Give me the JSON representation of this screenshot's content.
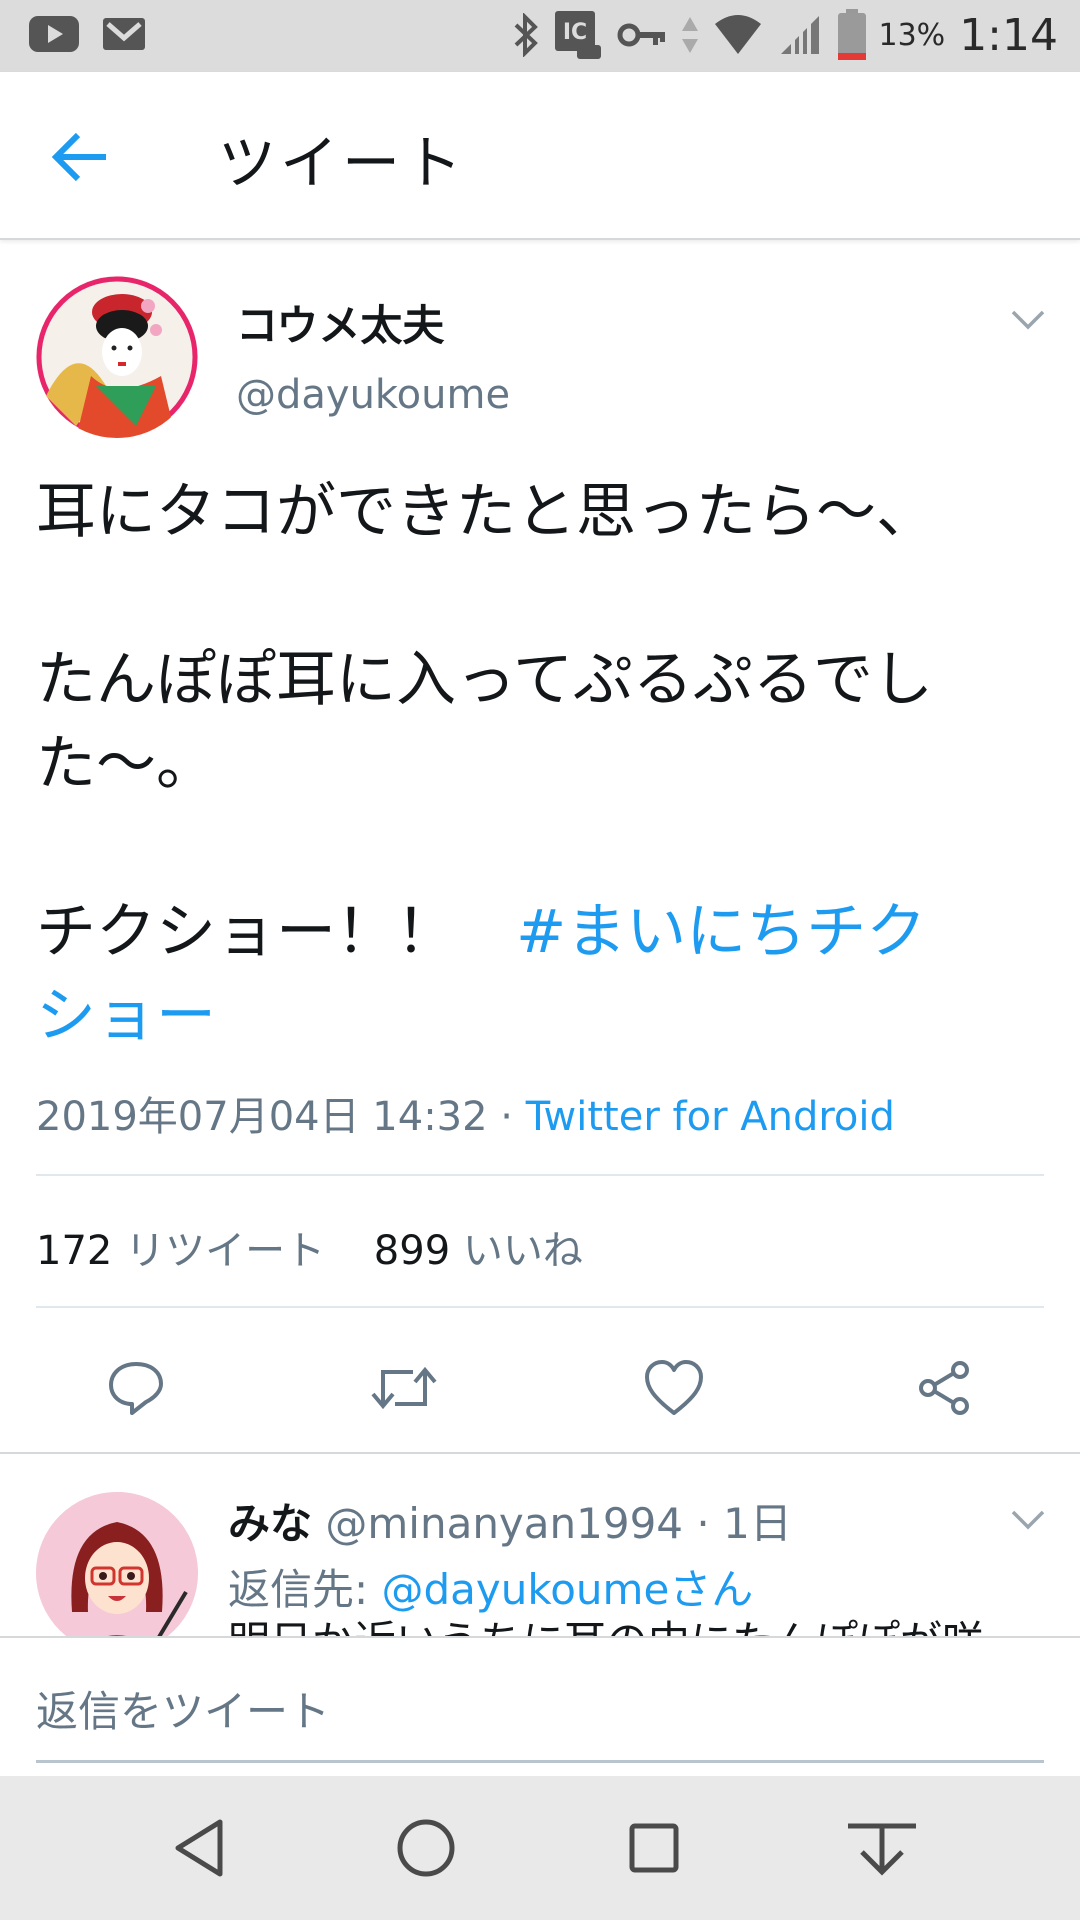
{
  "status_bar": {
    "battery": "13%",
    "time": "1:14",
    "icons": [
      "youtube-icon",
      "gmail-icon",
      "bluetooth-icon",
      "nfc-icon",
      "vpn-key-icon",
      "data-arrows-icon",
      "wifi-icon",
      "signal-icon",
      "battery-icon"
    ]
  },
  "header": {
    "title": "ツイート",
    "back_icon": "back-arrow-icon"
  },
  "tweet": {
    "name": "コウメ太夫",
    "handle": "@dayukoume",
    "body": {
      "p1": "耳にタコができたと思ったら〜、",
      "p2_l1": "たんぽぽ耳に入ってぷるぷるでし",
      "p2_l2": "た〜。",
      "p3_text": "チクショー！！　",
      "p3_hashtag_l1": "#まいにちチク",
      "p3_hashtag_l2": "ショー"
    },
    "timestamp": "2019年07月04日 14:32 · ",
    "source": "Twitter for Android",
    "retweets": "172",
    "retweets_label": "リツイート",
    "likes": "899",
    "likes_label": "いいね",
    "actions": [
      "reply-icon",
      "retweet-icon",
      "like-icon",
      "share-icon"
    ]
  },
  "reply": {
    "name": "みな",
    "handle": "@minanyan1994",
    "age": "· 1日",
    "reply_to_prefix": "返信先: ",
    "reply_to": "@dayukoumeさん",
    "text_preview": "明日か近いうちに耳の中にたんぽぽが咲"
  },
  "composer": {
    "placeholder": "返信をツイート"
  },
  "nav": [
    "back-triangle-icon",
    "home-circle-icon",
    "recents-square-icon",
    "notification-pull-icon"
  ],
  "colors": {
    "accent": "#1d9bf0",
    "secondary_text": "#657786",
    "status_bar_bg": "#dcdcdc",
    "nav_bar_bg": "#e9e9e9"
  }
}
